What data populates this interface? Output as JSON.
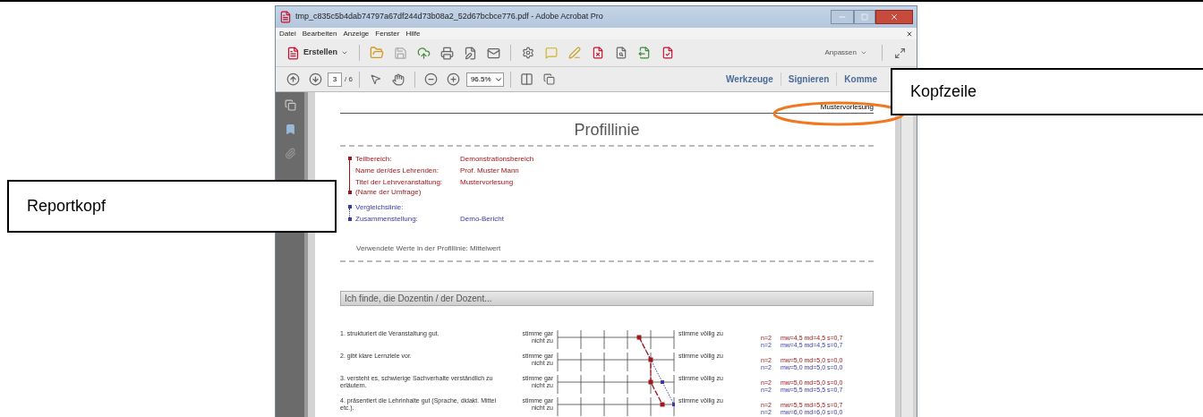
{
  "window": {
    "title": "tmp_c835c5b4dab74797a67df244d73b08a2_52d67bcbce776.pdf - Adobe Acrobat Pro"
  },
  "menu": [
    "Datei",
    "Bearbeiten",
    "Anzeige",
    "Fenster",
    "Hilfe"
  ],
  "toolbar": {
    "create_button": "Erstellen",
    "customize_button": "Anpassen"
  },
  "navigation": {
    "page": "3",
    "page_count": "/ 6",
    "zoom": "96.5%",
    "panels": [
      "Werkzeuge",
      "Signieren",
      "Komme"
    ]
  },
  "document": {
    "header": "Mustervorlesung",
    "title": "Profillinie",
    "report_groups": [
      {
        "color": "#a0171c",
        "rows": [
          {
            "label": "Teilbereich:",
            "value": "Demonstrationsbereich"
          },
          {
            "label": "Name der/des Lehrenden:",
            "value": "Prof. Muster Mann"
          },
          {
            "label": "Titel der Lehrveranstaltung: (Name der Umfrage)",
            "value": "Mustervorlesung"
          }
        ]
      },
      {
        "color": "#3a3aa8",
        "rows": [
          {
            "label": "Vergleichslinie:"
          },
          {
            "label": "Zusammenstellung:",
            "value": "Demo-Bericht"
          }
        ]
      }
    ],
    "values_note": "Verwendete Werte in der Profillinie: Mittelwert",
    "section": "Ich finde, die Dozentin / der Dozent...",
    "items": [
      {
        "question": "1. strukturiert die Veranstaltung gut.",
        "left_pole": "stimme gar nicht zu",
        "right_pole": "stimme völlig zu",
        "stats": [
          {
            "n": "n=2",
            "summary": "mw=4,5 md=4,5 s=0,7"
          },
          {
            "n": "n=2",
            "summary": "mw=4,5 md=4,5 s=0,7"
          }
        ]
      },
      {
        "question": "2. gibt klare Lernziele vor.",
        "left_pole": "stimme gar nicht zu",
        "right_pole": "stimme völlig zu",
        "stats": [
          {
            "n": "n=2",
            "summary": "mw=5,0 md=5,0 s=0,0"
          },
          {
            "n": "n=2",
            "summary": "mw=5,0 md=5,0 s=0,0"
          }
        ]
      },
      {
        "question": "3. versteht es, schwierige Sachverhalte verständlich zu erläutern.",
        "left_pole": "stimme gar nicht zu",
        "right_pole": "stimme völlig zu",
        "stats": [
          {
            "n": "n=2",
            "summary": "mw=5,0 md=5,0 s=0,0"
          },
          {
            "n": "n=2",
            "summary": "mw=5,5 md=5,5 s=0,7"
          }
        ]
      },
      {
        "question": "4. präsentiert die Lehrinhalte gut (Sprache, didakt. Mittel etc.).",
        "left_pole": "stimme gar nicht zu",
        "right_pole": "stimme völlig zu",
        "stats": [
          {
            "n": "n=2",
            "summary": "mw=5,5 md=5,5 s=0,7"
          },
          {
            "n": "n=2",
            "summary": "mw=6,0 md=6,0 s=0,0"
          }
        ]
      }
    ]
  },
  "callouts": [
    {
      "text": "Reportkopf"
    },
    {
      "text": "Kopfzeile"
    }
  ]
}
